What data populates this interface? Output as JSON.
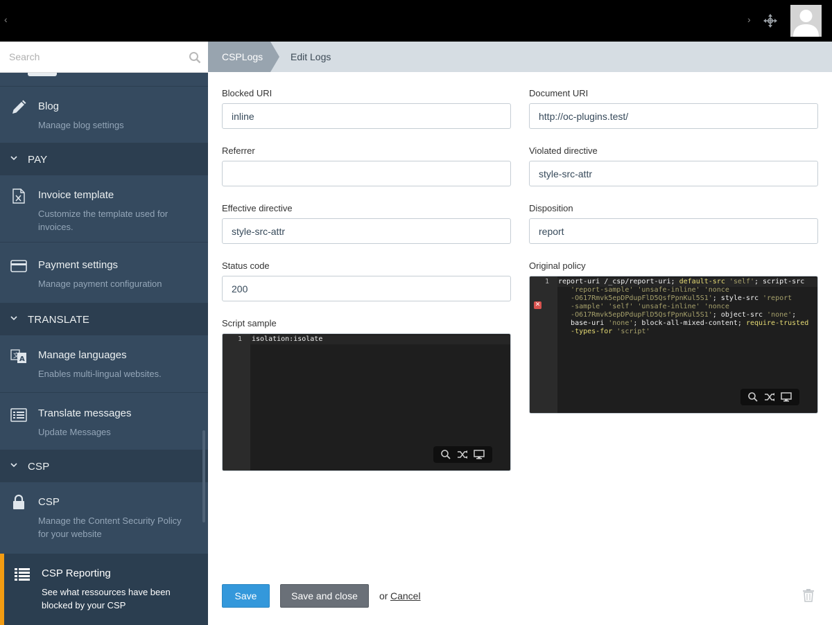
{
  "topbar": {
    "nav_left": "‹",
    "nav_right": "›"
  },
  "sidebar": {
    "search_placeholder": "Search",
    "items": [
      {
        "icon": "pencil-icon",
        "title": "Blog",
        "desc": "Manage blog settings"
      },
      {
        "icon": "invoice-icon",
        "title": "Invoice template",
        "desc": "Customize the template used for invoices."
      },
      {
        "icon": "credit-card-icon",
        "title": "Payment settings",
        "desc": "Manage payment configuration"
      },
      {
        "icon": "language-icon",
        "title": "Manage languages",
        "desc": "Enables multi-lingual websites."
      },
      {
        "icon": "list-icon",
        "title": "Translate messages",
        "desc": "Update Messages"
      },
      {
        "icon": "lock-icon",
        "title": "CSP",
        "desc": "Manage the Content Security Policy for your website"
      },
      {
        "icon": "list-icon",
        "title": "CSP Reporting",
        "desc": "See what ressources have been blocked by your CSP"
      }
    ],
    "groups": [
      {
        "label": "PAY"
      },
      {
        "label": "TRANSLATE"
      },
      {
        "label": "CSP"
      }
    ],
    "accent_color": "#f39c12"
  },
  "breadcrumb": {
    "root": "CSPLogs",
    "current": "Edit Logs"
  },
  "form": {
    "blocked_uri": {
      "label": "Blocked URI",
      "value": "inline"
    },
    "document_uri": {
      "label": "Document URI",
      "value": "http://oc-plugins.test/"
    },
    "referrer": {
      "label": "Referrer",
      "value": ""
    },
    "violated_directive": {
      "label": "Violated directive",
      "value": "style-src-attr"
    },
    "effective_directive": {
      "label": "Effective directive",
      "value": "style-src-attr"
    },
    "disposition": {
      "label": "Disposition",
      "value": "report"
    },
    "status_code": {
      "label": "Status code",
      "value": "200"
    },
    "script_sample": {
      "label": "Script sample",
      "line_number": "1",
      "code": "isolation:isolate"
    },
    "original_policy": {
      "label": "Original policy",
      "line_number": "1"
    }
  },
  "actions": {
    "save": "Save",
    "save_close": "Save and close",
    "or": "or",
    "cancel": "Cancel"
  }
}
